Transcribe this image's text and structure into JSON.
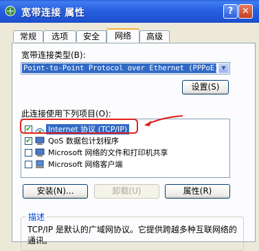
{
  "window": {
    "title": "宽带连接 属性",
    "help_label": "?",
    "close_label": "✕"
  },
  "tabs": [
    {
      "label": "常规"
    },
    {
      "label": "选项"
    },
    {
      "label": "安全"
    },
    {
      "label": "网络",
      "active": true
    },
    {
      "label": "高级"
    }
  ],
  "network": {
    "type_label": "宽带连接类型(B):",
    "type_value": "Point-to-Point Protocol over Ethernet (PPPoE)",
    "settings_button": "设置(S)",
    "items_label": "此连接使用下列项目(O):",
    "items": [
      {
        "label": "Internet 协议 (TCP/IP)",
        "checked": true,
        "selected": true,
        "icon": "network-protocol-icon"
      },
      {
        "label": "QoS 数据包计划程序",
        "checked": true,
        "selected": false,
        "icon": "network-service-icon"
      },
      {
        "label": "Microsoft 网络的文件和打印机共享",
        "checked": false,
        "selected": false,
        "icon": "network-service-icon"
      },
      {
        "label": "Microsoft 网络客户端",
        "checked": false,
        "selected": false,
        "icon": "network-client-icon"
      }
    ],
    "install_button": "安装(N)...",
    "uninstall_button": "卸载(U)",
    "properties_button": "属性(R)",
    "description_title": "描述",
    "description_text": "TCP/IP 是默认的广域网协议。它提供跨越多种互联网络的通讯。"
  },
  "colors": {
    "highlight_box": "#e0201c",
    "selection": "#316ac5",
    "title_bar": "#2860e0"
  }
}
